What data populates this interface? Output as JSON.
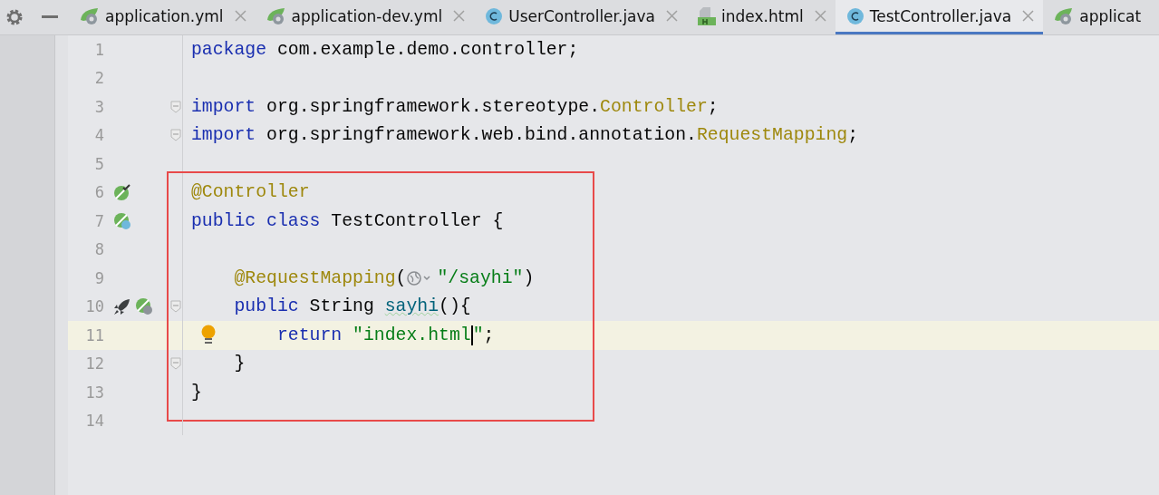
{
  "tabs": [
    {
      "label": "application.yml",
      "kind": "yml",
      "selected": false,
      "closable": true
    },
    {
      "label": "application-dev.yml",
      "kind": "yml",
      "selected": false,
      "closable": true
    },
    {
      "label": "UserController.java",
      "kind": "java",
      "selected": false,
      "closable": true
    },
    {
      "label": "index.html",
      "kind": "html",
      "selected": false,
      "closable": true
    },
    {
      "label": "TestController.java",
      "kind": "java",
      "selected": true,
      "closable": true
    },
    {
      "label": "applicat",
      "kind": "yml",
      "selected": false
    }
  ],
  "editor": {
    "blocks": [
      {
        "lines": [
          {
            "number": "1",
            "tokens": [
              {
                "kind": "keyword",
                "text": "package"
              },
              {
                "kind": "plain",
                "text": " com.example.demo.controller;"
              }
            ]
          },
          {
            "number": "2"
          },
          {
            "number": "3",
            "fold": true,
            "tokens": [
              {
                "kind": "keyword",
                "text": "import"
              },
              {
                "kind": "plain",
                "text": " org.springframework.stereotype."
              },
              {
                "kind": "annotation",
                "text": "Controller"
              },
              {
                "kind": "plain",
                "text": ";"
              }
            ]
          },
          {
            "number": "4",
            "fold": true,
            "tokens": [
              {
                "kind": "keyword",
                "text": "import"
              },
              {
                "kind": "plain",
                "text": " org.springframework.web.bind.annotation."
              },
              {
                "kind": "annotation",
                "text": "RequestMapping"
              },
              {
                "kind": "plain",
                "text": ";"
              }
            ]
          },
          {
            "number": "5"
          }
        ]
      },
      {
        "boxed": true,
        "lines": [
          {
            "number": "6",
            "gutter": [
              {
                "kind": "bean-check"
              }
            ],
            "tokens": [
              {
                "kind": "annotation",
                "text": "@Controller"
              }
            ]
          },
          {
            "number": "7",
            "gutter": [
              {
                "kind": "bean-class"
              }
            ],
            "tokens": [
              {
                "kind": "keyword",
                "text": "public class"
              },
              {
                "kind": "plain",
                "text": " TestController {"
              }
            ]
          },
          {
            "number": "8"
          },
          {
            "number": "9",
            "tokens": [
              {
                "kind": "indent"
              },
              {
                "kind": "annotation",
                "text": "@RequestMapping"
              },
              {
                "kind": "plain",
                "text": "("
              },
              {
                "kind": "web-inlay"
              },
              {
                "kind": "string",
                "text": "\"/sayhi\""
              },
              {
                "kind": "plain",
                "text": ")"
              }
            ]
          },
          {
            "number": "10",
            "gutter": [
              {
                "kind": "rocket"
              },
              {
                "kind": "bean-web"
              }
            ],
            "fold": true,
            "tokens": [
              {
                "kind": "indent"
              },
              {
                "kind": "keyword",
                "text": "public"
              },
              {
                "kind": "plain",
                "text": " String "
              },
              {
                "kind": "method",
                "text": "sayhi"
              },
              {
                "kind": "plain",
                "text": "(){"
              }
            ]
          },
          {
            "number": "11",
            "current": true,
            "bulb": true,
            "tokens": [
              {
                "kind": "indent"
              },
              {
                "kind": "indent"
              },
              {
                "kind": "keyword",
                "text": "return"
              },
              {
                "kind": "string",
                "text": " \"index.html"
              },
              {
                "kind": "caret"
              },
              {
                "kind": "string",
                "text": "\""
              },
              {
                "kind": "plain",
                "text": ";"
              }
            ]
          },
          {
            "number": "12",
            "fold": true,
            "tokens": [
              {
                "kind": "indent"
              },
              {
                "kind": "plain",
                "text": "}"
              }
            ]
          },
          {
            "number": "13",
            "tokens": [
              {
                "kind": "plain",
                "text": "}"
              }
            ]
          }
        ]
      },
      {
        "lines": [
          {
            "number": "14"
          }
        ]
      }
    ]
  }
}
